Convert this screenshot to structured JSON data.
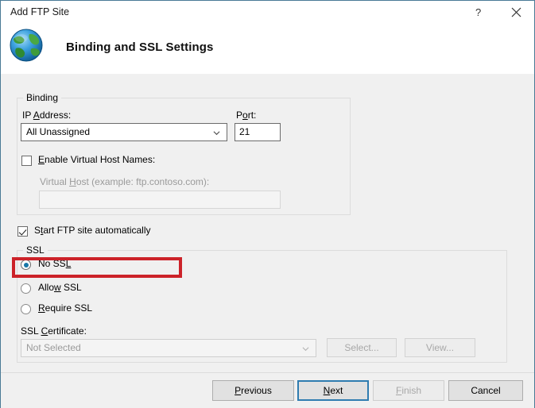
{
  "window": {
    "title": "Add FTP Site",
    "help_icon": "question-mark-icon",
    "close_icon": "close-icon"
  },
  "header": {
    "icon": "globe-icon",
    "title": "Binding and SSL Settings"
  },
  "binding": {
    "legend": "Binding",
    "ip_label_pre": "IP ",
    "ip_label_accel": "A",
    "ip_label_post": "ddress:",
    "ip_value": "All Unassigned",
    "ip_chevron": "chevron-down-icon",
    "port_label_pre": "P",
    "port_label_accel": "o",
    "port_label_post": "rt:",
    "port_value": "21",
    "vhost_checkbox_pre": "",
    "vhost_checkbox_accel": "E",
    "vhost_checkbox_post": "nable Virtual Host Names:",
    "vhost_checked": false,
    "vhost_label_pre": "Virtual ",
    "vhost_label_accel": "H",
    "vhost_label_post": "ost (example: ftp.contoso.com):",
    "vhost_value": "",
    "vhost_placeholder": ""
  },
  "start_auto": {
    "label_pre": "S",
    "label_accel": "t",
    "label_post": "art FTP site automatically",
    "checked": true
  },
  "ssl": {
    "legend": "SSL",
    "options": [
      {
        "label_pre": "No SS",
        "label_accel": "L",
        "label_post": "",
        "selected": true
      },
      {
        "label_pre": "Allo",
        "label_accel": "w",
        "label_post": " SSL",
        "selected": false
      },
      {
        "label_pre": "",
        "label_accel": "R",
        "label_post": "equire SSL",
        "selected": false
      }
    ],
    "cert_label_pre": "SSL ",
    "cert_label_accel": "C",
    "cert_label_post": "ertificate:",
    "cert_value": "Not Selected",
    "cert_chevron": "chevron-down-icon",
    "select_button": "Select...",
    "view_button": "View..."
  },
  "footer": {
    "previous_pre": "",
    "previous_accel": "P",
    "previous_post": "revious",
    "next_pre": "",
    "next_accel": "N",
    "next_post": "ext",
    "finish_pre": "",
    "finish_accel": "F",
    "finish_post": "inish",
    "cancel": "Cancel"
  },
  "annotation": {
    "color": "#cc2229",
    "target": "no-ssl-radio"
  }
}
